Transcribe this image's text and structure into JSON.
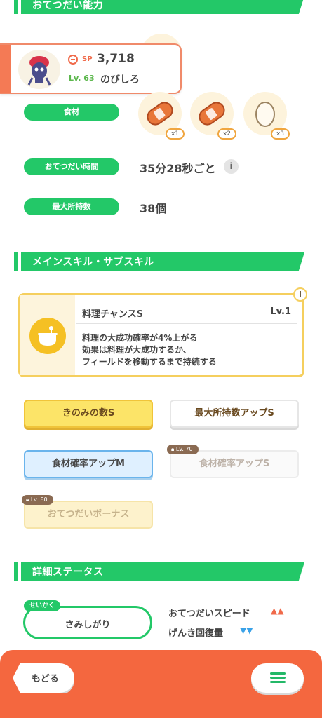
{
  "sections": {
    "help_ability": "おてつだい能力",
    "main_sub_skill": "メインスキル・サブスキル",
    "detail_status": "詳細ステータス"
  },
  "pokemon": {
    "sp_label": "SP",
    "sp_value": "3,718",
    "level": "Lv. 63",
    "name": "のびしろ"
  },
  "help": {
    "ingredient_label": "食材",
    "ingredients": [
      {
        "icon": "sausage-icon",
        "qty": "x1"
      },
      {
        "icon": "sausage-icon",
        "qty": "x2"
      },
      {
        "icon": "egg-icon",
        "qty": "x3"
      }
    ],
    "time_label": "おてつだい時間",
    "time_value": "35分28秒ごと",
    "max_label": "最大所持数",
    "max_value": "38個"
  },
  "main_skill": {
    "name": "料理チャンスS",
    "level": "Lv.1",
    "desc1": "料理の大成功確率が4%上がる",
    "desc2": "効果は料理が大成功するか、",
    "desc3": "フィールドを移動するまで持続する"
  },
  "sub_skills": [
    {
      "label": "きのみの数S",
      "style": "gold"
    },
    {
      "label": "最大所持数アップS",
      "style": "white"
    },
    {
      "label": "食材確率アップM",
      "style": "blue"
    },
    {
      "label": "食材確率アップS",
      "style": "locked",
      "lock": "Lv. 70"
    },
    {
      "label": "おてつだいボーナス",
      "style": "locked-gold",
      "lock": "Lv. 80"
    }
  ],
  "nature": {
    "tag": "せいかく",
    "value": "さみしがり",
    "up_label": "おてつだいスピード",
    "up_marks": "▲▲",
    "down_label": "げんき回復量",
    "down_marks": "▼▼"
  },
  "footer": {
    "back_label": "もどる"
  },
  "colors": {
    "green": "#23c868",
    "orange": "#f4673f",
    "gold": "#f5cf5e",
    "up_red": "#f06a4a",
    "down_blue": "#3aa2e8"
  }
}
